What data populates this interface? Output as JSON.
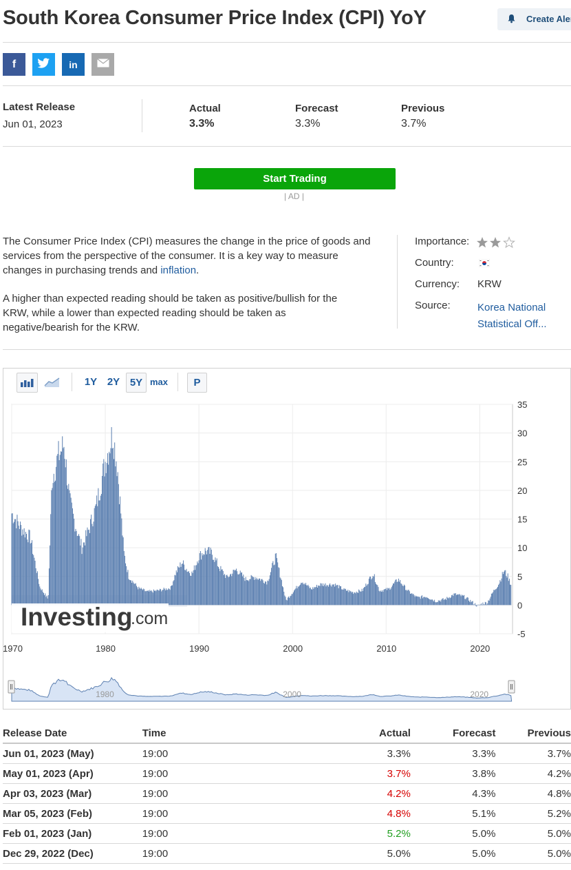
{
  "page": {
    "title": "South Korea Consumer Price Index (CPI) YoY",
    "alert_label": "Create Alert"
  },
  "share": [
    {
      "icon": "facebook-icon",
      "glyph": "f",
      "color": "#3b5998"
    },
    {
      "icon": "twitter-icon",
      "glyph": "t",
      "color": "#1da1f2"
    },
    {
      "icon": "linkedin-icon",
      "glyph": "in",
      "color": "#1769b3"
    },
    {
      "icon": "email-icon",
      "glyph": "✉",
      "color": "#a9a9a9"
    }
  ],
  "release": {
    "latest_label": "Latest Release",
    "latest_date": "Jun 01, 2023",
    "actual_label": "Actual",
    "actual_value": "3.3%",
    "forecast_label": "Forecast",
    "forecast_value": "3.3%",
    "previous_label": "Previous",
    "previous_value": "3.7%"
  },
  "cta": {
    "label": "Start Trading",
    "ad_label": "| AD |",
    "color": "#0aa50a"
  },
  "description": {
    "p1_before": "The Consumer Price Index (CPI) measures the change in the price of goods and services from the perspective of the consumer. It is a key way to measure changes in purchasing trends and ",
    "p1_link": "inflation",
    "p1_after": ".",
    "p2": "A higher than expected reading should be taken as positive/bullish for the KRW, while a lower than expected reading should be taken as negative/bearish for the KRW."
  },
  "info": {
    "importance_label": "Importance:",
    "importance_stars": 2,
    "importance_max": 3,
    "country_label": "Country:",
    "currency_label": "Currency:",
    "currency_value": "KRW",
    "source_label": "Source:",
    "source_value_line1": "Korea National",
    "source_value_line2": "Statistical Off..."
  },
  "chart_toolbar": {
    "bar_icon": "bar-chart-icon",
    "line_icon": "area-chart-icon",
    "ranges": [
      "1Y",
      "2Y",
      "5Y",
      "max"
    ],
    "selected_range": "5Y",
    "p_label": "P"
  },
  "watermark": {
    "brand": "Investing",
    "suffix": ".com"
  },
  "chart_data": {
    "type": "bar",
    "xlabel": "",
    "ylabel": "",
    "x_ticks": [
      1970,
      1980,
      1990,
      2000,
      2010,
      2020
    ],
    "y_ticks": [
      35,
      30,
      25,
      20,
      15,
      10,
      5,
      0,
      -5
    ],
    "xlim": [
      1970,
      2023.5
    ],
    "ylim": [
      -5,
      35
    ],
    "navigator_ticks": [
      1980,
      2000,
      2020
    ],
    "bar_color": "#5b7fb0",
    "series_points": [
      [
        1970.0,
        16
      ],
      [
        1971.0,
        13.5
      ],
      [
        1972.0,
        11.7
      ],
      [
        1973.0,
        3.2
      ],
      [
        1973.9,
        1.0
      ],
      [
        1974.3,
        22
      ],
      [
        1975.0,
        26
      ],
      [
        1975.6,
        28
      ],
      [
        1976.2,
        18
      ],
      [
        1976.8,
        14
      ],
      [
        1977.5,
        10
      ],
      [
        1978.2,
        13
      ],
      [
        1979.0,
        17
      ],
      [
        1980.0,
        25
      ],
      [
        1980.8,
        30
      ],
      [
        1981.3,
        24
      ],
      [
        1982.0,
        9
      ],
      [
        1982.5,
        5
      ],
      [
        1983.5,
        3
      ],
      [
        1984.5,
        2.3
      ],
      [
        1985.5,
        2.5
      ],
      [
        1986.5,
        2.8
      ],
      [
        1987.0,
        3.0
      ],
      [
        1987.5,
        5.5
      ],
      [
        1988.2,
        7.5
      ],
      [
        1988.8,
        6
      ],
      [
        1989.3,
        5.5
      ],
      [
        1990.0,
        8.5
      ],
      [
        1990.7,
        9.5
      ],
      [
        1991.4,
        9.0
      ],
      [
        1992.2,
        6.5
      ],
      [
        1993.0,
        4.8
      ],
      [
        1994.0,
        6.2
      ],
      [
        1995.0,
        4.5
      ],
      [
        1996.0,
        4.9
      ],
      [
        1997.3,
        4.0
      ],
      [
        1998.2,
        8.5
      ],
      [
        1998.8,
        4.5
      ],
      [
        1999.3,
        0.8
      ],
      [
        2000.0,
        2.2
      ],
      [
        2001.0,
        4.2
      ],
      [
        2002.0,
        2.8
      ],
      [
        2003.0,
        3.6
      ],
      [
        2004.5,
        3.6
      ],
      [
        2005.5,
        2.7
      ],
      [
        2006.5,
        2.2
      ],
      [
        2007.5,
        2.6
      ],
      [
        2008.6,
        5.5
      ],
      [
        2009.3,
        2.5
      ],
      [
        2010.3,
        2.8
      ],
      [
        2011.3,
        4.5
      ],
      [
        2012.3,
        2.5
      ],
      [
        2013.3,
        1.3
      ],
      [
        2014.3,
        1.5
      ],
      [
        2015.3,
        0.7
      ],
      [
        2016.3,
        1.0
      ],
      [
        2017.3,
        1.9
      ],
      [
        2018.3,
        1.5
      ],
      [
        2019.3,
        0.4
      ],
      [
        2019.8,
        -0.2
      ],
      [
        2020.3,
        0.3
      ],
      [
        2020.8,
        0.4
      ],
      [
        2021.5,
        2.5
      ],
      [
        2022.0,
        3.6
      ],
      [
        2022.6,
        6.0
      ],
      [
        2023.0,
        5.0
      ],
      [
        2023.4,
        3.3
      ]
    ]
  },
  "history": {
    "headers": {
      "date": "Release Date",
      "time": "Time",
      "actual": "Actual",
      "forecast": "Forecast",
      "previous": "Previous"
    },
    "rows": [
      {
        "date": "Jun 01, 2023 (May)",
        "time": "19:00",
        "actual": "3.3%",
        "actual_color": "neutral",
        "forecast": "3.3%",
        "previous": "3.7%"
      },
      {
        "date": "May 01, 2023 (Apr)",
        "time": "19:00",
        "actual": "3.7%",
        "actual_color": "red",
        "forecast": "3.8%",
        "previous": "4.2%"
      },
      {
        "date": "Apr 03, 2023 (Mar)",
        "time": "19:00",
        "actual": "4.2%",
        "actual_color": "red",
        "forecast": "4.3%",
        "previous": "4.8%"
      },
      {
        "date": "Mar 05, 2023 (Feb)",
        "time": "19:00",
        "actual": "4.8%",
        "actual_color": "red",
        "forecast": "5.1%",
        "previous": "5.2%"
      },
      {
        "date": "Feb 01, 2023 (Jan)",
        "time": "19:00",
        "actual": "5.2%",
        "actual_color": "green",
        "forecast": "5.0%",
        "previous": "5.0%"
      },
      {
        "date": "Dec 29, 2022 (Dec)",
        "time": "19:00",
        "actual": "5.0%",
        "actual_color": "neutral",
        "forecast": "5.0%",
        "previous": "5.0%"
      }
    ]
  }
}
